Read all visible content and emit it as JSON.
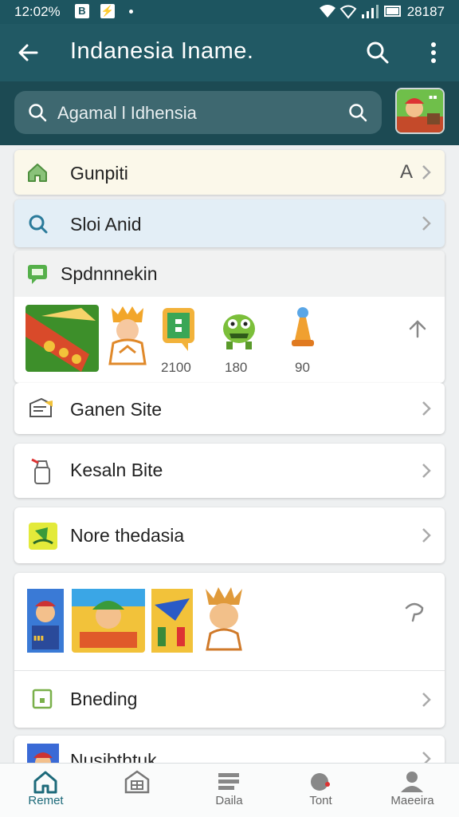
{
  "status_bar": {
    "time": "12:02%",
    "right_text": "28187"
  },
  "app_bar": {
    "title": "Indanesia Iname."
  },
  "search": {
    "placeholder": "Agamal l Idhensia"
  },
  "menu_top": [
    {
      "label": "Gunpiti",
      "trailing": "A"
    },
    {
      "label": "Sloi Anid"
    }
  ],
  "section_header": {
    "label": "Spdnnnekin"
  },
  "game_row_1": {
    "counts": [
      "2100",
      "180",
      "90"
    ]
  },
  "menu_items": [
    {
      "label": "Ganen Site"
    },
    {
      "label": "Kesaln Bite"
    },
    {
      "label": "Nore thedasia"
    }
  ],
  "list_bottom": [
    {
      "label": "Bneding"
    },
    {
      "label": "Nusibthtuk"
    }
  ],
  "bottom_nav": [
    {
      "label": "Remet"
    },
    {
      "label": ""
    },
    {
      "label": "Daila"
    },
    {
      "label": "Tont"
    },
    {
      "label": "Maeeira"
    }
  ],
  "colors": {
    "header": "#215964",
    "accent": "#1d6a7a"
  }
}
